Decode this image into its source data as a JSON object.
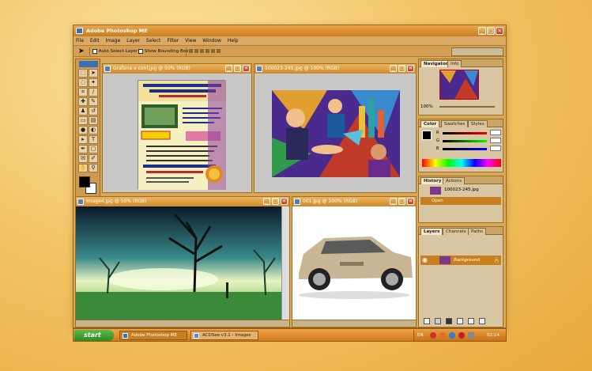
{
  "app": {
    "title": "Adobe Photoshop ME"
  },
  "menu": [
    "File",
    "Edit",
    "Image",
    "Layer",
    "Select",
    "Filter",
    "View",
    "Window",
    "Help"
  ],
  "options": {
    "auto_select_layer": "Auto Select Layer",
    "show_bounding_box": "Show Bounding Box"
  },
  "docs": {
    "flyer": {
      "title": "Grafana e conf.jpg @ 50% (RGB)"
    },
    "art": {
      "title": "100023-245.jpg @ 100% (RGB)"
    },
    "tree": {
      "title": "Image4.jpg @ 50% (RGB)"
    },
    "car": {
      "title": "001.jpg @ 100% (RGB)"
    }
  },
  "navigator": {
    "tab1": "Navigator",
    "tab2": "Info",
    "zoom": "100%"
  },
  "color": {
    "tab1": "Color",
    "tab2": "Swatches",
    "tab3": "Styles",
    "r": "R",
    "g": "G",
    "b": "B"
  },
  "history": {
    "tab1": "History",
    "tab2": "Actions",
    "file": "100023-245.jpg",
    "step": "Open"
  },
  "layers": {
    "tab1": "Layers",
    "tab2": "Channels",
    "tab3": "Paths",
    "layer": "Background"
  },
  "taskbar": {
    "start": "start",
    "task1": "Adobe Photoshop ME",
    "task2": "ACDSee v3.1 - Images",
    "lang": "EN",
    "clock": "02:14"
  },
  "colors": {
    "accent": "#e0a040",
    "title": "#cf8a2c",
    "start": "#3a9a2c"
  }
}
